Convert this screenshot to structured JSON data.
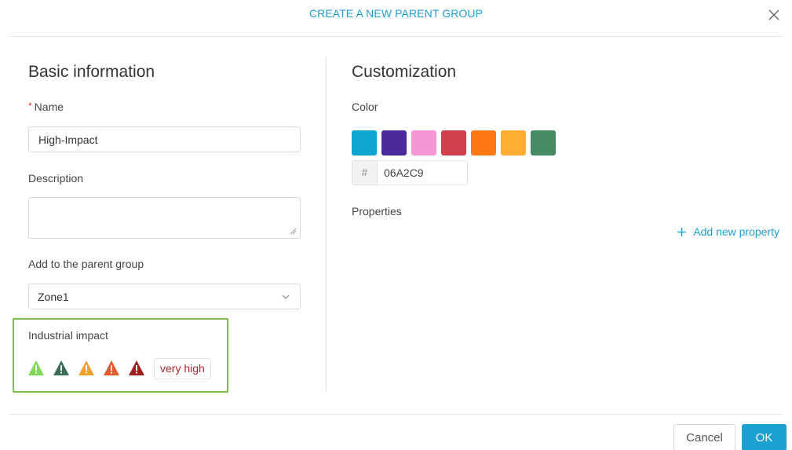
{
  "dialog": {
    "title": "CREATE A NEW PARENT GROUP"
  },
  "basic": {
    "section_title": "Basic information",
    "name_required_mark": "*",
    "name_label": "Name",
    "name_value": "High-Impact",
    "description_label": "Description",
    "description_value": "",
    "parent_label": "Add to the parent group",
    "parent_value": "Zone1"
  },
  "impact": {
    "label": "Industrial impact",
    "levels": [
      {
        "icon": "warning-triangle-icon",
        "color": "#7ed957"
      },
      {
        "icon": "warning-triangle-icon",
        "color": "#3b6a57"
      },
      {
        "icon": "warning-triangle-icon",
        "color": "#f2a12e"
      },
      {
        "icon": "warning-triangle-icon",
        "color": "#e05a2b"
      },
      {
        "icon": "warning-triangle-icon",
        "color": "#a01e1e"
      }
    ],
    "selected_label": "very high"
  },
  "custom": {
    "section_title": "Customization",
    "color_label": "Color",
    "swatches": [
      "#0ea5cf",
      "#4b2b9b",
      "#f597d4",
      "#d1414b",
      "#ff7a14",
      "#ffad33",
      "#448a62"
    ],
    "hex_prefix": "#",
    "hex_value": "06A2C9",
    "properties_label": "Properties",
    "add_property_label": "Add new property"
  },
  "footer": {
    "cancel_label": "Cancel",
    "ok_label": "OK"
  },
  "colors": {
    "accent": "#1ba0d2",
    "highlight_border": "#7ac04a"
  }
}
